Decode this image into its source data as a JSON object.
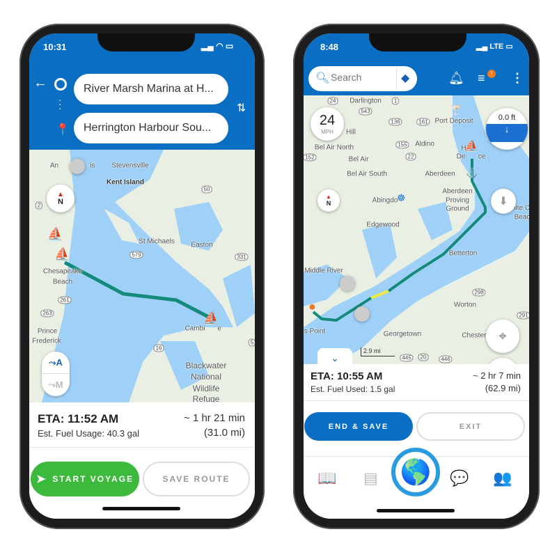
{
  "colors": {
    "header_blue": "#0a6fc2",
    "route": "#138a7a",
    "start_green": "#3dba3c",
    "water": "#9fd0f7",
    "land": "#e9efe3"
  },
  "left": {
    "status": {
      "time": "10:31"
    },
    "header": {
      "origin": "River Marsh Marina at H...",
      "destination": "Herrington Harbour Sou..."
    },
    "map": {
      "labels": [
        "An",
        "is",
        "Stevensville",
        "Kent Island",
        "St Michaels",
        "Easton",
        "Chesapeake",
        "Beach",
        "Prince",
        "Frederick",
        "Cambi",
        "e",
        "Blackwater",
        "National",
        "Wildlife",
        "Refuge"
      ],
      "shields": [
        "2",
        "50",
        "579",
        "331",
        "261",
        "263",
        "16",
        "5"
      ],
      "compass": "N",
      "layer_auto": "A",
      "layer_manual": "M"
    },
    "summary": {
      "eta": "ETA: 11:52 AM",
      "fuel": "Est. Fuel Usage: 40.3 gal",
      "duration": "~ 1 hr 21 min",
      "distance": "(31.0 mi)"
    },
    "buttons": {
      "start": "START VOYAGE",
      "save": "SAVE ROUTE"
    }
  },
  "right": {
    "status": {
      "time": "8:48",
      "network": "LTE"
    },
    "header": {
      "search_placeholder": "Search",
      "filter_badge": "!"
    },
    "map": {
      "labels": [
        "Darlington",
        "Port Deposit",
        "Hill",
        "Bel Air North",
        "Bel Air",
        "Bel Air South",
        "Aldino",
        "Aberdeen",
        "Aberdeen",
        "Proving",
        "Ground",
        "Abingdo",
        "Edgewood",
        "White Cr",
        "Beac",
        "Betterton",
        "Middle River",
        "Worton",
        "s Point",
        "Georgetown",
        "Chesterto",
        "H",
        "De",
        "ce"
      ],
      "shields": [
        "24",
        "543",
        "1",
        "136",
        "161",
        "155",
        "22",
        "152",
        "298",
        "291",
        "445",
        "20",
        "446"
      ],
      "speed": "24",
      "speed_unit": "MPH",
      "depth": "0.0 ft",
      "compass": "N",
      "scale": "2.9 mi"
    },
    "summary": {
      "eta": "ETA: 10:55 AM",
      "fuel": "Est. Fuel Used: 1.5 gal",
      "duration": "~ 2 hr 7 min",
      "distance": "(62.9 mi)"
    },
    "buttons": {
      "end_save": "END & SAVE",
      "exit": "EXIT"
    },
    "nav": [
      "logbook-icon",
      "list-icon",
      "globe-icon",
      "chat-icon",
      "people-icon"
    ]
  }
}
